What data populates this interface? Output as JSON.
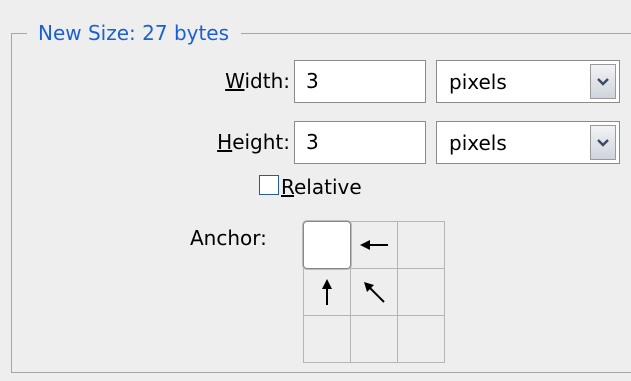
{
  "group": {
    "legend": "New Size: 27 bytes"
  },
  "width": {
    "label_first": "W",
    "label_rest": "idth:",
    "value": "3",
    "unit": "pixels"
  },
  "height": {
    "label_first": "H",
    "label_rest": "eight:",
    "value": "3",
    "unit": "pixels"
  },
  "relative": {
    "label_first": "R",
    "label_rest": "elative",
    "checked": false
  },
  "anchor": {
    "label": "Anchor:",
    "cells": [
      {
        "icon": "none",
        "selected": true
      },
      {
        "icon": "arrow-left-icon",
        "selected": false
      },
      {
        "icon": "none",
        "selected": false
      },
      {
        "icon": "arrow-up-icon",
        "selected": false
      },
      {
        "icon": "arrow-up-left-icon",
        "selected": false
      },
      {
        "icon": "none",
        "selected": false
      },
      {
        "icon": "none",
        "selected": false
      },
      {
        "icon": "none",
        "selected": false
      },
      {
        "icon": "none",
        "selected": false
      }
    ]
  },
  "colors": {
    "legend": "#1c5fd1",
    "panel_bg": "#eeeeee"
  }
}
